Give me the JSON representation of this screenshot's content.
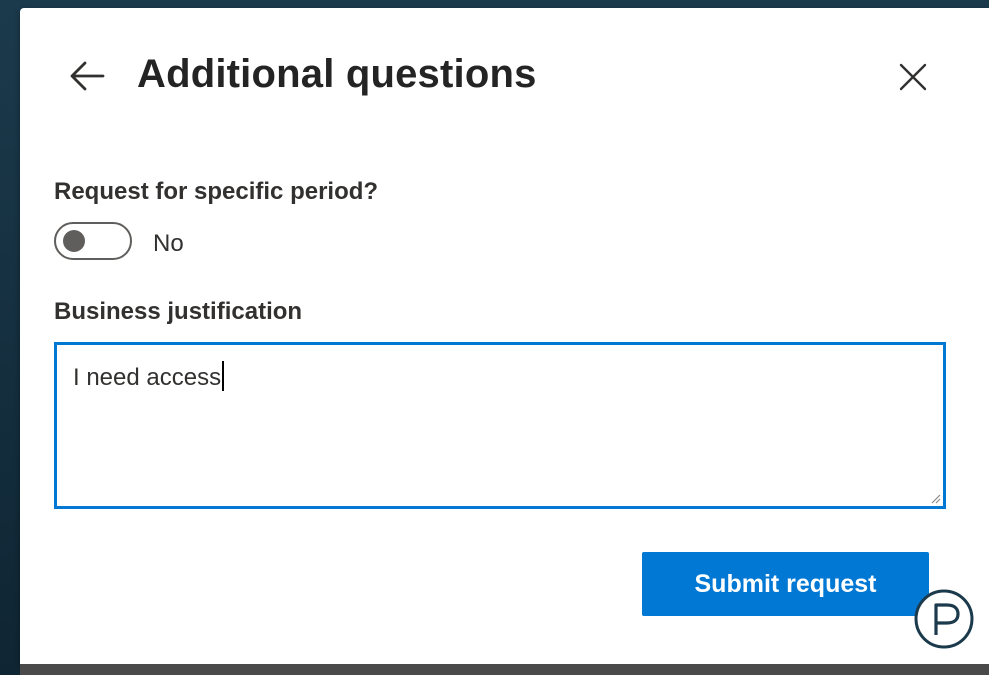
{
  "dialog": {
    "title": "Additional questions",
    "back_icon": "arrow-left-icon",
    "close_icon": "close-icon"
  },
  "period_question": {
    "label": "Request for specific period?",
    "toggle_state": "off",
    "toggle_text": "No"
  },
  "justification": {
    "label": "Business justification",
    "value": "I need access",
    "resize_icon": "resize-grip-icon"
  },
  "actions": {
    "submit_label": "Submit request"
  },
  "colors": {
    "accent": "#0078d4",
    "text_primary": "#242424",
    "text_secondary": "#323130",
    "toggle_off": "#605e5c",
    "backdrop": "#1b3a4c"
  },
  "watermark": {
    "icon": "circled-p-logo-icon"
  }
}
